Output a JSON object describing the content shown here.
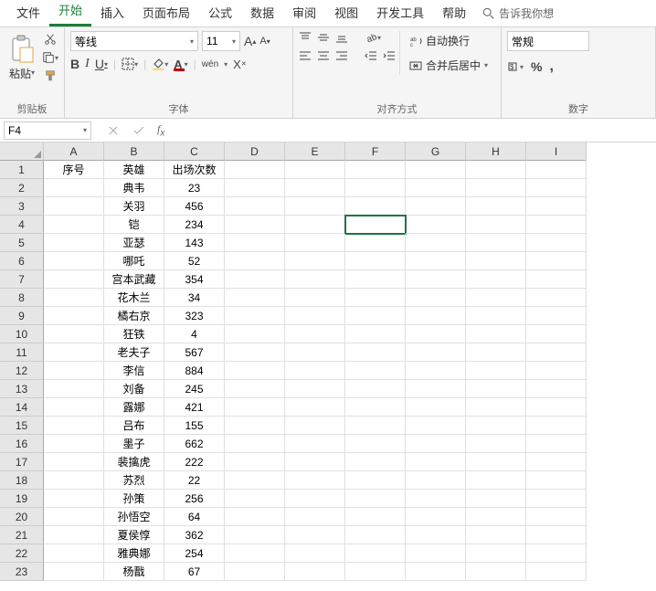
{
  "tabs": {
    "file": "文件",
    "home": "开始",
    "insert": "插入",
    "pagelayout": "页面布局",
    "formulas": "公式",
    "data": "数据",
    "review": "审阅",
    "view": "视图",
    "developer": "开发工具",
    "help": "帮助",
    "tellme": "告诉我你想"
  },
  "ribbon": {
    "clipboard": {
      "label": "剪贴板",
      "paste": "粘贴"
    },
    "font": {
      "label": "字体",
      "name": "等线",
      "size": "11",
      "wen": "wén",
      "x": "X"
    },
    "alignment": {
      "label": "对齐方式",
      "wrap": "自动换行",
      "merge": "合并后居中"
    },
    "number": {
      "label": "数字",
      "format": "常规"
    }
  },
  "namebox": {
    "ref": "F4"
  },
  "sheet": {
    "columns": [
      "A",
      "B",
      "C",
      "D",
      "E",
      "F",
      "G",
      "H",
      "I"
    ],
    "selected": {
      "row": 4,
      "col": "F"
    },
    "rows": [
      {
        "n": 1,
        "A": "序号",
        "B": "英雄",
        "C": "出场次数"
      },
      {
        "n": 2,
        "B": "典韦",
        "C": "23"
      },
      {
        "n": 3,
        "B": "关羽",
        "C": "456"
      },
      {
        "n": 4,
        "B": "铠",
        "C": "234"
      },
      {
        "n": 5,
        "B": "亚瑟",
        "C": "143"
      },
      {
        "n": 6,
        "B": "哪吒",
        "C": "52"
      },
      {
        "n": 7,
        "B": "宫本武藏",
        "C": "354"
      },
      {
        "n": 8,
        "B": "花木兰",
        "C": "34"
      },
      {
        "n": 9,
        "B": "橘右京",
        "C": "323"
      },
      {
        "n": 10,
        "B": "狂铁",
        "C": "4"
      },
      {
        "n": 11,
        "B": "老夫子",
        "C": "567"
      },
      {
        "n": 12,
        "B": "李信",
        "C": "884"
      },
      {
        "n": 13,
        "B": "刘备",
        "C": "245"
      },
      {
        "n": 14,
        "B": "露娜",
        "C": "421"
      },
      {
        "n": 15,
        "B": "吕布",
        "C": "155"
      },
      {
        "n": 16,
        "B": "墨子",
        "C": "662"
      },
      {
        "n": 17,
        "B": "裴擒虎",
        "C": "222"
      },
      {
        "n": 18,
        "B": "苏烈",
        "C": "22"
      },
      {
        "n": 19,
        "B": "孙策",
        "C": "256"
      },
      {
        "n": 20,
        "B": "孙悟空",
        "C": "64"
      },
      {
        "n": 21,
        "B": "夏侯惇",
        "C": "362"
      },
      {
        "n": 22,
        "B": "雅典娜",
        "C": "254"
      },
      {
        "n": 23,
        "B": "杨戬",
        "C": "67"
      }
    ]
  }
}
